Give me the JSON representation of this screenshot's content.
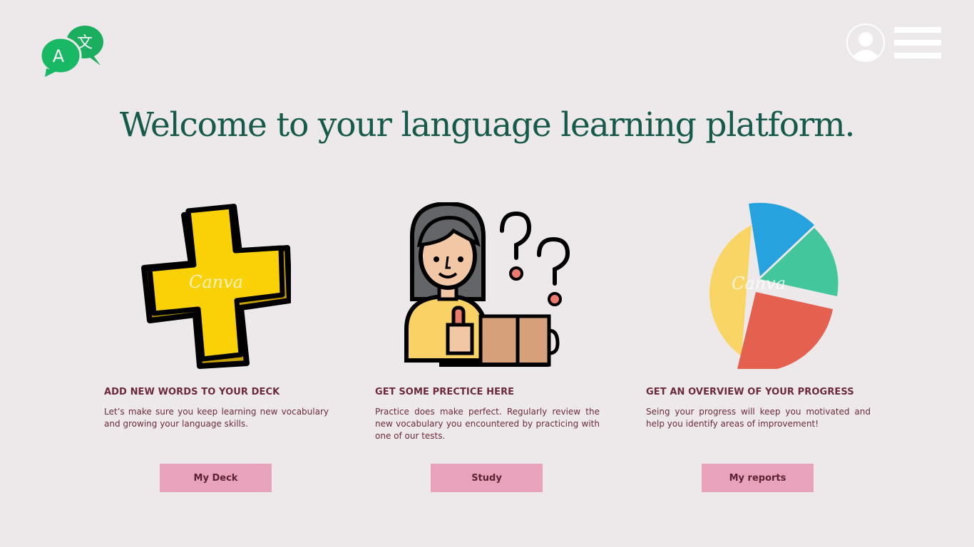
{
  "header": {
    "logo_glyph_a": "A",
    "logo_glyph_b": "文"
  },
  "main": {
    "title": "Welcome to your language learning platform."
  },
  "cards": [
    {
      "heading": "ADD NEW WORDS TO YOUR DECK",
      "body": "Let’s make sure you keep learning new vocabulary and growing your language skills.",
      "button": "My Deck",
      "icon": "plus-icon"
    },
    {
      "heading": "GET SOME PRECTICE HERE",
      "body": "Practice does make perfect. Regularly review the new vocabulary you encountered by practicing with one of our tests.",
      "button": "Study",
      "icon": "student-icon"
    },
    {
      "heading": "GET AN OVERVIEW OF YOUR PROGRESS",
      "body": "Seing your progress will keep you motivated and help you identify areas of improvement!",
      "button": "My reports",
      "icon": "pie-chart-icon"
    }
  ],
  "watermark": "Canva",
  "colors": {
    "background": "#ede9ea",
    "title": "#155a4a",
    "text": "#6b2a3c",
    "button": "#e8a2bb",
    "brand_green": "#1aae5e"
  }
}
